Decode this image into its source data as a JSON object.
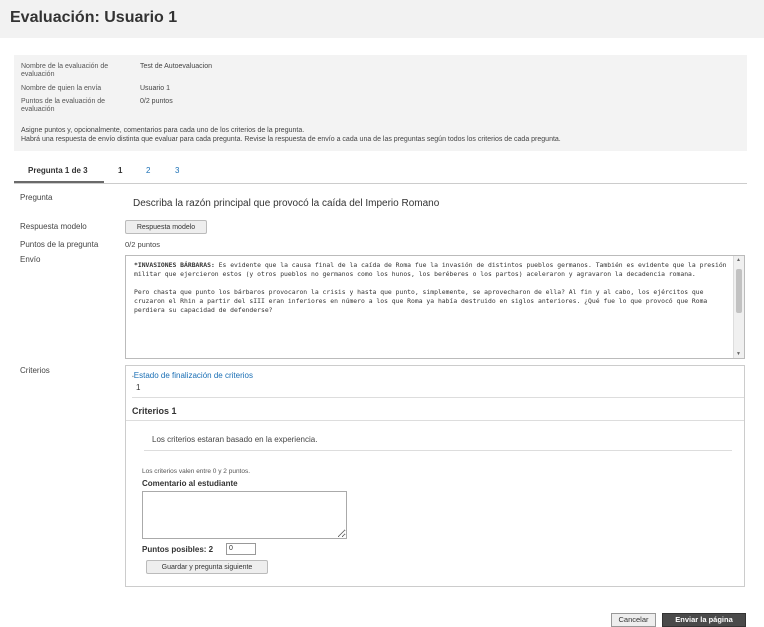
{
  "header": {
    "title": "Evaluación: Usuario 1"
  },
  "info": {
    "rows": [
      {
        "label": "Nombre de la evaluación de evaluación",
        "value": "Test de Autoevaluacion"
      },
      {
        "label": "Nombre de quien la envía",
        "value": "Usuario 1"
      },
      {
        "label": "Puntos de la evaluación de evaluación",
        "value": "0/2 puntos"
      }
    ],
    "instructions_line1": "Asigne puntos y, opcionalmente, comentarios para cada uno de los criterios de la pregunta.",
    "instructions_line2": "Habrá una respuesta de envío distinta que evaluar para cada pregunta. Revise la respuesta de envío a cada una de las preguntas según todos los criterios de cada pregunta."
  },
  "tabs": {
    "label": "Pregunta 1 de 3",
    "items": [
      "1",
      "2",
      "3"
    ],
    "active": "1"
  },
  "question": {
    "pregunta_label": "Pregunta",
    "pregunta_text": "Describa la razón principal que provocó la caída del Imperio Romano",
    "modelo_label": "Respuesta modelo",
    "modelo_button": "Respuesta modelo",
    "puntos_label": "Puntos de la pregunta",
    "puntos_value": "0/2 puntos",
    "envio_label": "Envío",
    "envio_heading": "*INVASIONES BÁRBARAS:",
    "envio_p1": " Es evidente que la causa final de la caída de Roma fue la invasión de distintos pueblos germanos. También es evidente que la presión militar que ejercieron estos (y otros pueblos no germanos como los hunos, los beréberes o los partos) aceleraron y agravaron la decadencia romana.",
    "envio_p2": "Pero chasta que punto los bárbaros provocaron la crisis y hasta que punto, simplemente, se aprovecharon de ella? Al fin y al cabo, los ejércitos que cruzaron el Rhin a partir del sIII eran inferiores en número a los que Roma ya había destruido en siglos anteriores. ¿Qué fue lo que provocó que Roma perdiera su capacidad de defenderse?"
  },
  "criterios": {
    "label": "Criterios",
    "status_title": "Estado de finalización de criterios",
    "status_value": "1",
    "section_title": "Criterios 1",
    "description": "Los criterios estaran basado en la experiencia.",
    "range_text": "Los criterios valen entre 0 y 2 puntos.",
    "comment_label": "Comentario al estudiante",
    "comment_value": "",
    "puntos_label": "Puntos posibles: 2",
    "puntos_value": "0",
    "save_button": "Guardar y pregunta siguiente"
  },
  "footer": {
    "cancel": "Cancelar",
    "submit": "Enviar la página"
  }
}
